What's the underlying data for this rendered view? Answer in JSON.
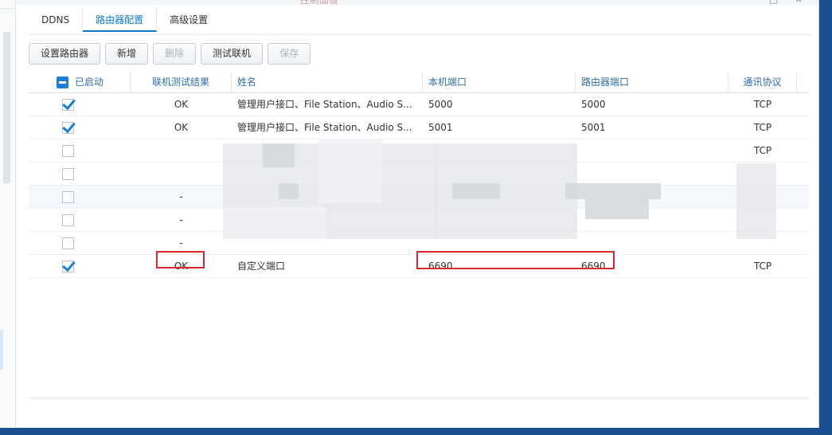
{
  "window": {
    "title": "控制面板"
  },
  "tabs": [
    {
      "label": "DDNS"
    },
    {
      "label": "路由器配置"
    },
    {
      "label": "高级设置"
    }
  ],
  "toolbar": {
    "setup_router": "设置路由器",
    "add": "新增",
    "delete": "删除",
    "test_connection": "测试联机",
    "save": "保存"
  },
  "table": {
    "headers": {
      "enabled": "已启动",
      "test_result": "联机测试结果",
      "name": "姓名",
      "local_port": "本机端口",
      "router_port": "路由器端口",
      "protocol": "通讯协议"
    },
    "rows": [
      {
        "checked": true,
        "test_result": "OK",
        "name": "管理用户接口、File Station、Audio S...",
        "local_port": "5000",
        "router_port": "5000",
        "protocol": "TCP"
      },
      {
        "checked": true,
        "test_result": "OK",
        "name": "管理用户接口、File Station、Audio S...",
        "local_port": "5001",
        "router_port": "5001",
        "protocol": "TCP"
      },
      {
        "checked": false,
        "test_result": "",
        "name": "",
        "local_port": "",
        "router_port": "",
        "protocol": "TCP"
      },
      {
        "checked": false,
        "test_result": "",
        "name": "",
        "local_port": "",
        "router_port": "",
        "protocol": ""
      },
      {
        "checked": false,
        "test_result": "-",
        "name": "",
        "local_port": "",
        "router_port": "",
        "protocol": ""
      },
      {
        "checked": false,
        "test_result": "-",
        "name": "",
        "local_port": "",
        "router_port": "",
        "protocol": ""
      },
      {
        "checked": false,
        "test_result": "-",
        "name": "",
        "local_port": "",
        "router_port": "",
        "protocol": ""
      },
      {
        "checked": true,
        "test_result": "OK",
        "name": "自定义端口",
        "local_port": "6690",
        "router_port": "6690",
        "protocol": "TCP"
      }
    ]
  },
  "colors": {
    "accent": "#0b78d0",
    "highlight": "#d9282e"
  }
}
